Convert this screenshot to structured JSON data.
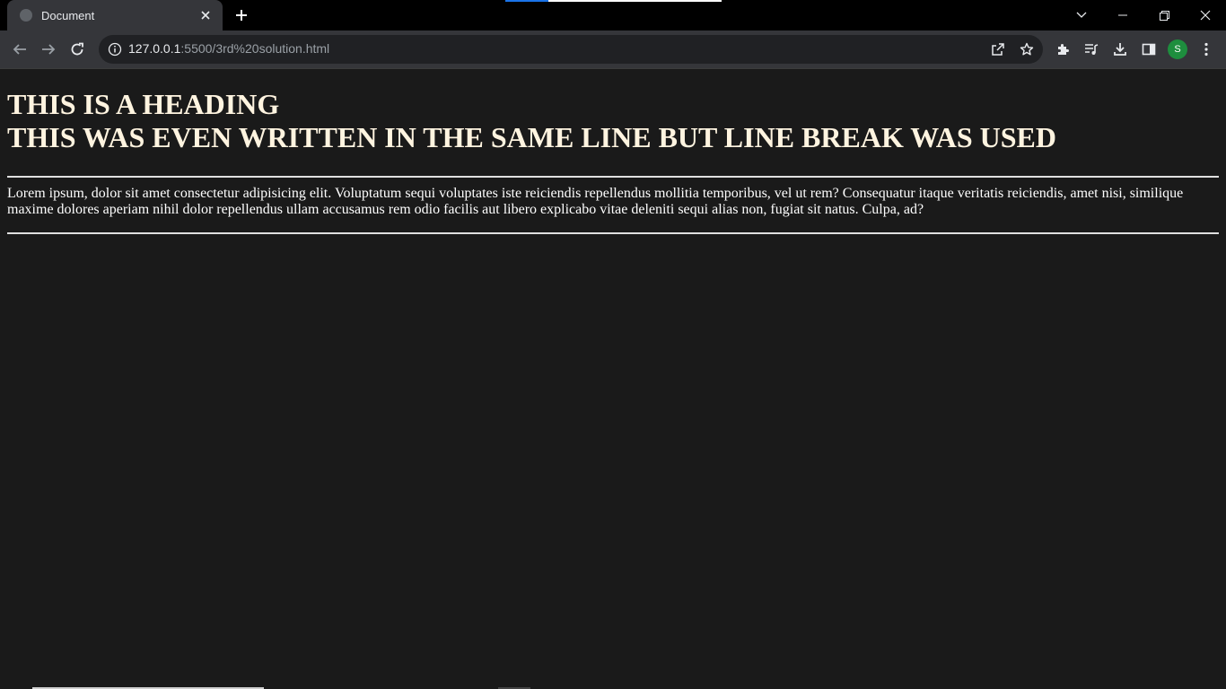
{
  "tab": {
    "title": "Document",
    "favicon": "globe-icon"
  },
  "toolbar": {
    "url_host": "127.0.0.1",
    "url_path": ":5500/3rd%20solution.html",
    "profile_initial": "S"
  },
  "content": {
    "heading_line1": "THIS IS A HEADING",
    "heading_line2": "THIS WAS EVEN WRITTEN IN THE SAME LINE BUT LINE BREAK WAS USED",
    "paragraph": "Lorem ipsum, dolor sit amet consectetur adipisicing elit. Voluptatum sequi voluptates iste reiciendis repellendus mollitia temporibus, vel ut rem? Consequatur itaque veritatis reiciendis, amet nisi, similique maxime dolores aperiam nihil dolor repellendus ullam accusamus rem odio facilis aut libero explicabo vitae deleniti sequi alias non, fugiat sit natus. Culpa, ad?"
  },
  "colors": {
    "page_background": "#1a1a1a",
    "heading_color": "#fff4e0",
    "toolbar": "#35363a",
    "avatar": "#1e8e3e"
  }
}
